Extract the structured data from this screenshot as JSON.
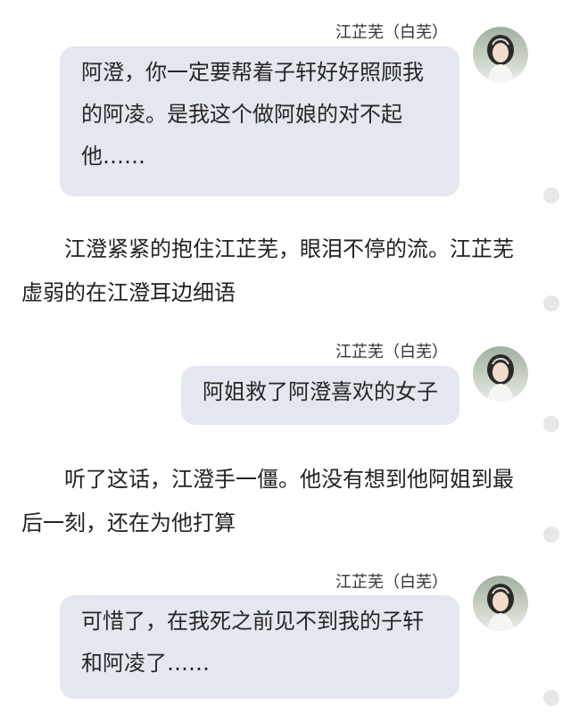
{
  "speaker_name": "江芷芜（白芜）",
  "messages": [
    {
      "text": "阿澄，你一定要帮着子轩好好照顾我的阿凌。是我这个做阿娘的对不起他……"
    },
    {
      "text": "阿姐救了阿澄喜欢的女子"
    },
    {
      "text": "可惜了，在我死之前见不到我的子轩和阿凌了……"
    }
  ],
  "narration": [
    "江澄紧紧的抱住江芷芜，眼泪不停的流。江芷芜虚弱的在江澄耳边细语",
    "听了这话，江澄手一僵。他没有想到他阿姐到最后一刻，还在为他打算"
  ],
  "colors": {
    "bubble": "#e4e7f0",
    "text": "#222222",
    "dot": "#e7e7e7"
  },
  "icons": [
    "avatar",
    "scroll-dot"
  ]
}
